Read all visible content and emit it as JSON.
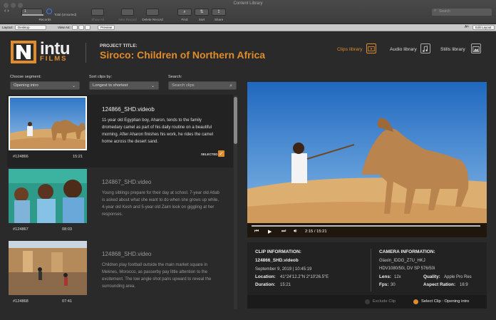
{
  "window": {
    "title": "Content Library"
  },
  "toolbar": {
    "records_label": "Records",
    "records_count": "1",
    "total_label": "Total (Unsorted)",
    "show_all": "Show All",
    "new_record": "New Record",
    "delete_record": "Delete Record",
    "find": "Find",
    "sort": "Sort",
    "share": "Share",
    "search_placeholder": "Search"
  },
  "layout_bar": {
    "layout_label": "Layout:",
    "layout_value": "Desktop",
    "view_as_label": "View As:",
    "preview": "Preview",
    "font_size": "Aᴬ",
    "edit_layout": "Edit Layout"
  },
  "brand": {
    "word": "intu",
    "sub": "FILMS"
  },
  "project": {
    "label": "PROJECT TITLE:",
    "title": "Siroco: Children of Northern Africa"
  },
  "libraries": [
    {
      "label": "Clips library",
      "active": true
    },
    {
      "label": "Audio library",
      "active": false
    },
    {
      "label": "Stills library",
      "active": false
    }
  ],
  "filters": {
    "segment_label": "Choose segment:",
    "segment_value": "Opening intro",
    "sort_label": "Sort clips by:",
    "sort_value": "Longest to shortest",
    "search_label": "Search:",
    "search_placeholder": "Search clips"
  },
  "clips": [
    {
      "id": "#124866",
      "duration": "15:21",
      "name": "124866_SHD.videob",
      "description": "11-year old Egyptian boy, Aharon, tends to the family dromedary camel as part of his daily routine on a beautiful morning.  After Aharon finishes his work, he rides the camel home across the desert sand.",
      "selected": true,
      "selected_label": "SELECTED"
    },
    {
      "id": "#124867",
      "duration": "08:03",
      "name": "124867_SHD.video",
      "description": "Young siblings prepare for their day at school.  7-year old Atlab is asked about what she want to do when she grows up while, 4-year old Kesh and 5-year old Zaim look on giggling at her responses.",
      "selected": false
    },
    {
      "id": "#124868",
      "duration": "07:41",
      "name": "124868_SHD.video",
      "description": "Children play football outside the main market square in Meknes, Morocco, as passerby pay little attention to the excitement.  The low angle shot pans upward to reveal the surrounding area.",
      "selected": false
    }
  ],
  "player": {
    "time": "2:15 / 15:21"
  },
  "clip_info": {
    "heading": "CLIP INFORMATION:",
    "filename": "124866_SHD.videob",
    "datetime": "September 9, 2019  |  10:45:19",
    "location_label": "Location:",
    "location_value": "41°24'12.2\"N  2°10'26.5\"E",
    "duration_label": "Duration:",
    "duration_value": "15:21"
  },
  "camera_info": {
    "heading": "CAMERA INFORMATION:",
    "model": "Glaxin_IDDG_Z7U_HKJ",
    "format": "HDV1080/50i, DV SP 576/50i",
    "lens_label": "Lens:",
    "lens_value": "12x",
    "quality_label": "Quality:",
    "quality_value": "Apple Pro Res",
    "fps_label": "Fps:",
    "fps_value": "30",
    "aspect_label": "Aspect Ration:",
    "aspect_value": "16:9"
  },
  "actions": {
    "exclude": "Exclude Clip",
    "select": "Select Clip : Opening intro"
  },
  "colors": {
    "accent": "#e08b2c",
    "background": "#2a2a2a",
    "panel": "#222222"
  }
}
